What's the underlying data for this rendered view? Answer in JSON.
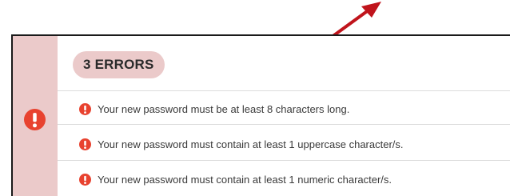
{
  "colors": {
    "sidebar_bg": "#ebcaca",
    "error_icon": "#e8422f",
    "arrow": "#c0141c",
    "text": "#3a3a3a"
  },
  "annotation": {
    "icon": "red-arrow-icon"
  },
  "error_panel": {
    "sidebar_icon": "exclamation-circle-icon",
    "count_label": "3 ERRORS",
    "errors": [
      {
        "icon": "exclamation-circle-icon",
        "text": "Your new password must be at least 8 characters long."
      },
      {
        "icon": "exclamation-circle-icon",
        "text": "Your new password must contain at least 1 uppercase character/s."
      },
      {
        "icon": "exclamation-circle-icon",
        "text": "Your new password must contain at least 1 numeric character/s."
      }
    ]
  }
}
